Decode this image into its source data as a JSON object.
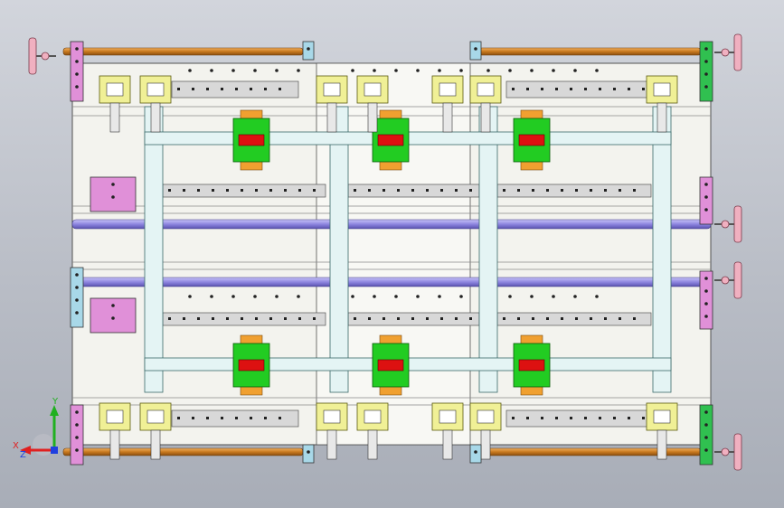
{
  "viewport": {
    "background_top": "#d2d5dc",
    "background_bottom": "#a8adb7"
  },
  "model": {
    "frame_color": "#f3f3ee",
    "frame_stroke": "#505050",
    "guide_rod_color": "#c8781e",
    "shaft_color": "#8e86e0",
    "clamp_color": "#f0f096",
    "carriage_green": "#22cc22",
    "carriage_red": "#dd1111",
    "carriage_orange": "#f0a030",
    "end_block_pink": "#e090d8",
    "end_block_green": "#30c050",
    "end_block_cyan": "#a8d8e8",
    "crossbar_color": "#e4f4f4",
    "handwheel_color": "#f0b0c0"
  },
  "axes_triad": {
    "x_label": "X",
    "y_label": "Y",
    "z_label": "Z",
    "x_color": "#e02020",
    "y_color": "#20b020",
    "z_color": "#2040e0"
  }
}
